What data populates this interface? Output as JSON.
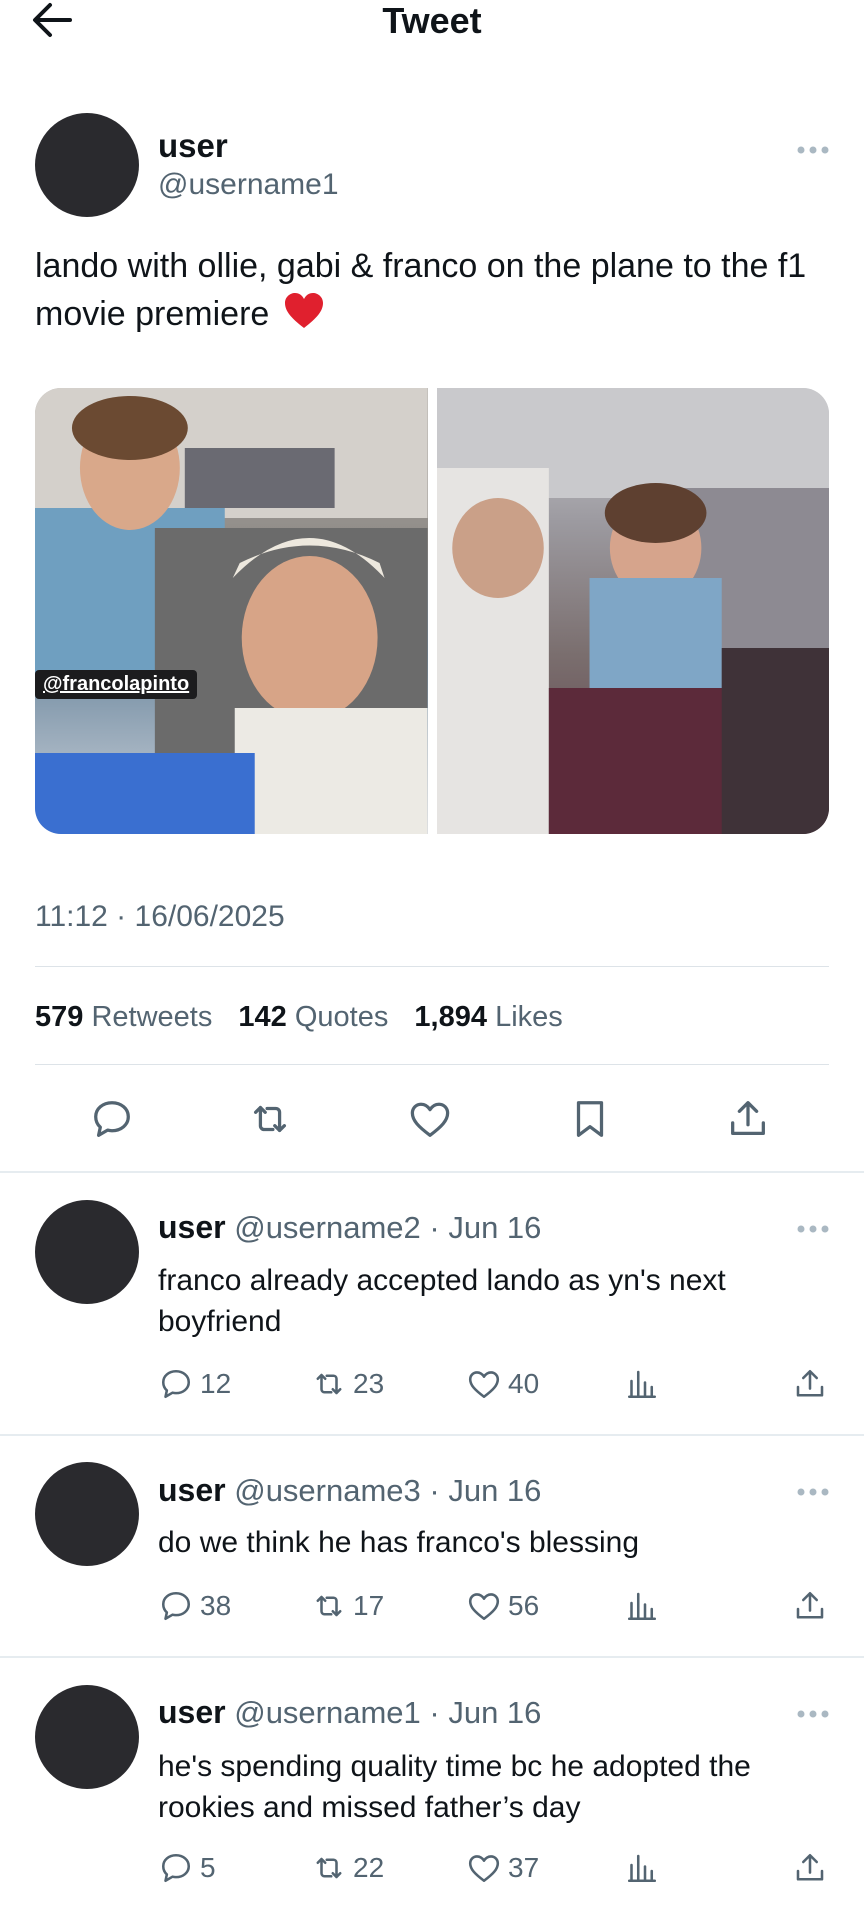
{
  "header": {
    "title": "Tweet"
  },
  "tweet": {
    "author_name": "user",
    "author_handle": "@username1",
    "text": "lando with ollie, gabi & franco on the plane to the f1 movie premiere",
    "emoji": "❤️",
    "media_overlay": "@francolapinto",
    "timestamp": "11:12 · 16/06/2025",
    "stats": {
      "retweets_count": "579",
      "retweets_label": "Retweets",
      "quotes_count": "142",
      "quotes_label": "Quotes",
      "likes_count": "1,894",
      "likes_label": "Likes"
    }
  },
  "replies": [
    {
      "name": "user",
      "meta": "@username2 · Jun 16",
      "text": "franco already accepted lando as yn's next boyfriend",
      "reply_count": "12",
      "retweet_count": "23",
      "like_count": "40"
    },
    {
      "name": "user",
      "meta": "@username3 · Jun 16",
      "text": "do we think he has franco's blessing",
      "reply_count": "38",
      "retweet_count": "17",
      "like_count": "56"
    },
    {
      "name": "user",
      "meta": "@username1 · Jun 16",
      "text": "he's spending quality time bc he adopted the rookies and missed father’s day",
      "reply_count": "5",
      "retweet_count": "22",
      "like_count": "37"
    }
  ]
}
